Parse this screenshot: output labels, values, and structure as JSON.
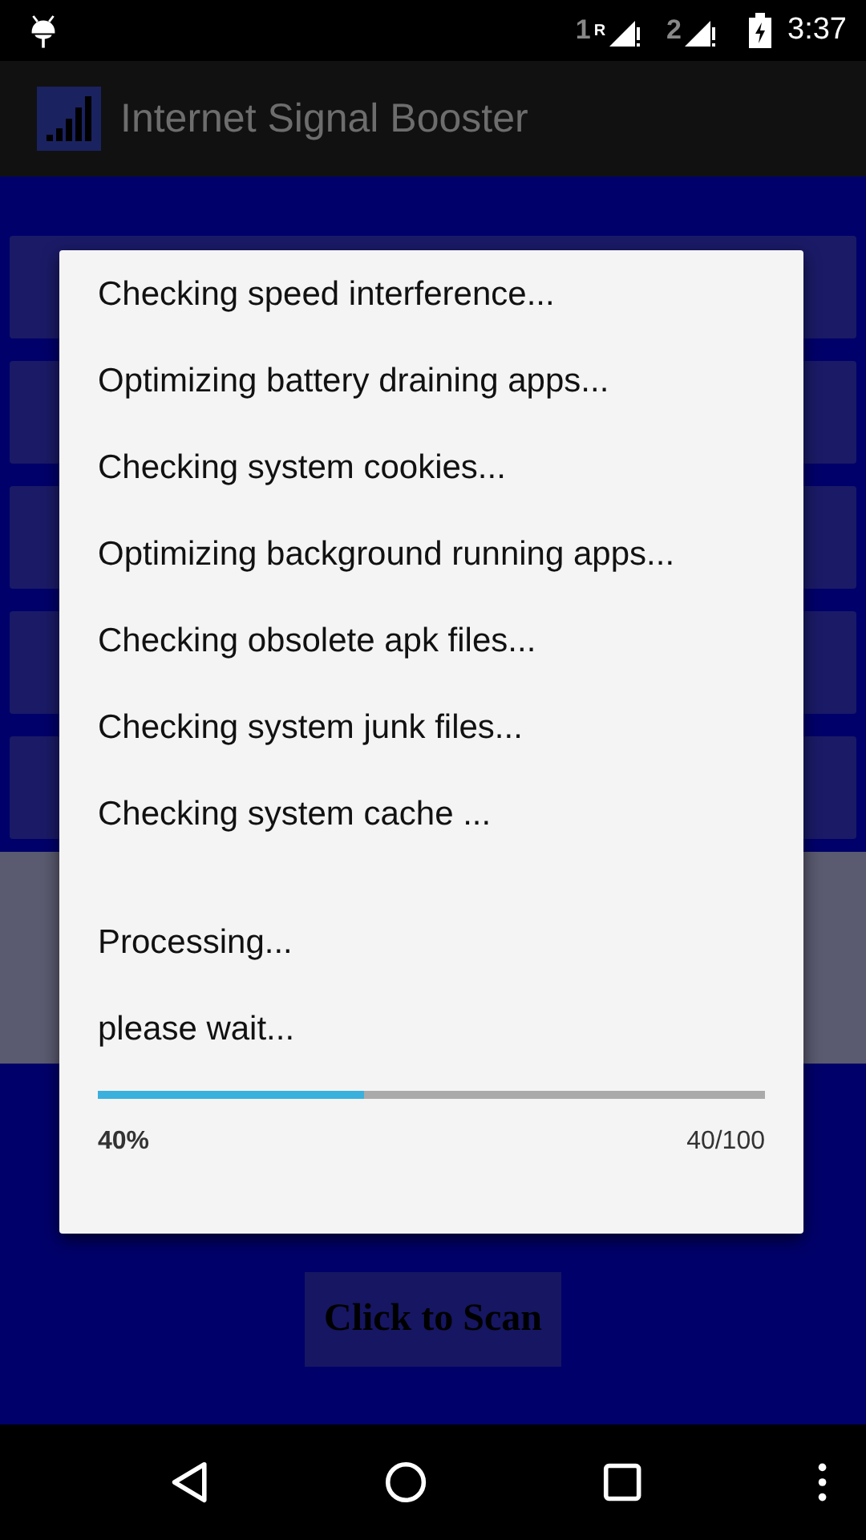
{
  "status_bar": {
    "sim1": "1",
    "roaming": "R",
    "sim2": "2",
    "time": "3:37"
  },
  "app_bar": {
    "title": "Internet Signal Booster"
  },
  "background": {
    "scan_button": "Click to Scan"
  },
  "dialog": {
    "steps": [
      "Checking speed interference...",
      "Optimizing battery draining apps...",
      "Checking system cookies...",
      "Optimizing background running apps...",
      "Checking obsolete apk files...",
      "Checking system junk files...",
      "Checking system cache ..."
    ],
    "status_lines": [
      "Processing...",
      "please wait..."
    ],
    "progress": {
      "level": 0.4,
      "percent": "40%",
      "count": "40/100"
    }
  }
}
